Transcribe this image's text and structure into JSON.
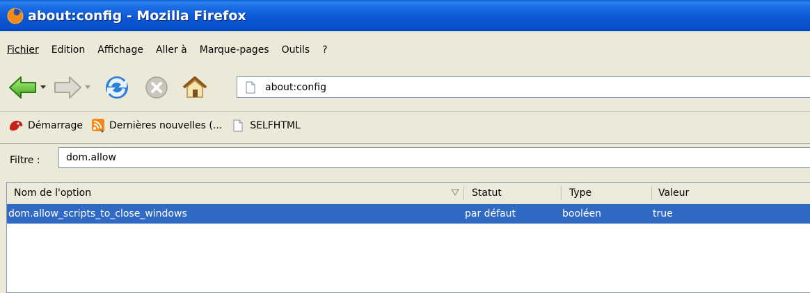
{
  "window": {
    "title": "about:config - Mozilla Firefox"
  },
  "menubar": {
    "items": [
      {
        "label": "Fichier",
        "access": "F"
      },
      {
        "label": "Edition",
        "access": "E"
      },
      {
        "label": "Affichage",
        "access": "A"
      },
      {
        "label": "Aller à",
        "access": "l"
      },
      {
        "label": "Marque-pages",
        "access": "M"
      },
      {
        "label": "Outils",
        "access": "t"
      },
      {
        "label": "?",
        "access": "?"
      }
    ]
  },
  "navbar": {
    "icons": [
      "back-icon",
      "forward-icon",
      "reload-icon",
      "stop-icon",
      "home-icon"
    ],
    "url": "about:config"
  },
  "bookmarks": {
    "items": [
      {
        "label": "Démarrage",
        "icon": "firefox-start-icon"
      },
      {
        "label": "Dernières nouvelles (...",
        "icon": "rss-icon"
      },
      {
        "label": "SELFHTML",
        "icon": "page-icon"
      }
    ]
  },
  "filter": {
    "label": "Filtre :",
    "value": "dom.allow"
  },
  "prefs_table": {
    "columns": [
      "Nom de l'option",
      "Statut",
      "Type",
      "Valeur"
    ],
    "rows": [
      {
        "name": "dom.allow_scripts_to_close_windows",
        "status": "par défaut",
        "type": "booléen",
        "value": "true",
        "selected": true
      }
    ]
  },
  "colors": {
    "title_bar": "#0b56d4",
    "selection": "#316ac5",
    "chrome": "#ece9d8"
  }
}
